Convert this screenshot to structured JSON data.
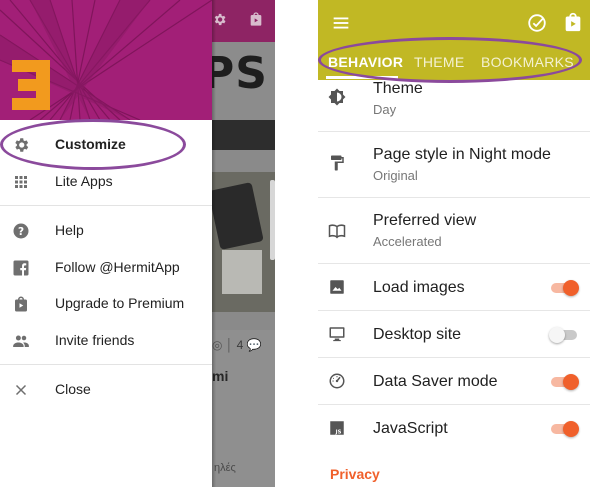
{
  "left_screen": {
    "background_app": {
      "banner_text": "PS",
      "meta_count": "4",
      "title_fragment": "mi",
      "bottom_fragment": "ηλές"
    },
    "drawer": {
      "logo": "hermit-logo",
      "groups": [
        [
          {
            "icon": "gear-icon",
            "label": "Customize"
          },
          {
            "icon": "apps-grid-icon",
            "label": "Lite Apps"
          }
        ],
        [
          {
            "icon": "help-icon",
            "label": "Help"
          },
          {
            "icon": "facebook-icon",
            "label": "Follow @HermitApp"
          },
          {
            "icon": "shopping-bag-icon",
            "label": "Upgrade to Premium"
          },
          {
            "icon": "people-icon",
            "label": "Invite friends"
          }
        ],
        [
          {
            "icon": "close-icon",
            "label": "Close"
          }
        ]
      ]
    }
  },
  "right_screen": {
    "toolbar": {
      "menu_icon": "hamburger-menu-icon",
      "actions": [
        "check-circle-icon",
        "shopping-bag-icon"
      ]
    },
    "tabs": [
      {
        "label": "BEHAVIOR",
        "active": true
      },
      {
        "label": "THEME",
        "active": false
      },
      {
        "label": "BOOKMARKS",
        "active": false
      }
    ],
    "settings": [
      {
        "icon": "theme-brightness-icon",
        "title": "Theme",
        "subtitle": "Day"
      },
      {
        "icon": "paint-roller-icon",
        "title": "Page style in Night mode",
        "subtitle": "Original"
      },
      {
        "icon": "book-open-icon",
        "title": "Preferred view",
        "subtitle": "Accelerated"
      },
      {
        "icon": "image-icon",
        "title": "Load images",
        "toggle": true
      },
      {
        "icon": "desktop-monitor-icon",
        "title": "Desktop site",
        "toggle": false
      },
      {
        "icon": "speedometer-icon",
        "title": "Data Saver mode",
        "toggle": true
      },
      {
        "icon": "javascript-file-icon",
        "title": "JavaScript",
        "toggle": true
      }
    ],
    "section_header": "Privacy"
  },
  "colors": {
    "drawer_header": "#a21f77",
    "logo_orange": "#f29a1e",
    "appbar": "#c1b824",
    "accent": "#f0602b",
    "annotation_oval": "#8b4a9c"
  }
}
